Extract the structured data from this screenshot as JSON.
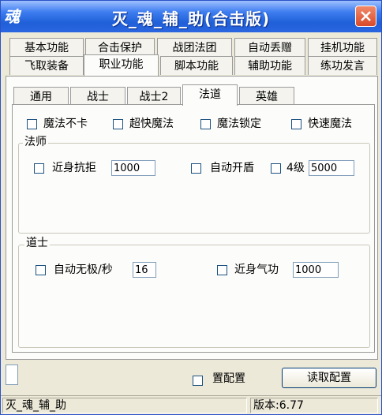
{
  "window": {
    "app_icon": "魂",
    "title": "灭_魂_辅_助(合击版)",
    "close_icon": "close-icon"
  },
  "tabs_row1": [
    {
      "label": "基本功能"
    },
    {
      "label": "合击保护"
    },
    {
      "label": "战团法团"
    },
    {
      "label": "自动丢赠"
    },
    {
      "label": "挂机功能"
    }
  ],
  "tabs_row2": [
    {
      "label": "飞取装备"
    },
    {
      "label": "职业功能"
    },
    {
      "label": "脚本功能"
    },
    {
      "label": "辅助功能"
    },
    {
      "label": "练功发言"
    }
  ],
  "subtabs": [
    {
      "label": "通用"
    },
    {
      "label": "战士"
    },
    {
      "label": "战士2"
    },
    {
      "label": "法道"
    },
    {
      "label": "英雄"
    }
  ],
  "top_checks": [
    {
      "label": "魔法不卡"
    },
    {
      "label": "超快魔法"
    },
    {
      "label": "魔法锁定"
    },
    {
      "label": "快速魔法"
    }
  ],
  "mage_group": {
    "title": "法师",
    "close_resist_label": "近身抗拒",
    "close_resist_value": "1000",
    "auto_shield_label": "自动开盾",
    "level4_label": "4级",
    "level4_value": "5000"
  },
  "taoist_group": {
    "title": "道士",
    "auto_wuji_label": "自动无极/秒",
    "auto_wuji_value": "16",
    "close_qigong_label": "近身气功",
    "close_qigong_value": "1000"
  },
  "bottom": {
    "small_field_value": "",
    "config_check_label": "置配置",
    "read_config_label": "读取配置"
  },
  "status": {
    "left_text": "灭_魂_辅_助",
    "version_text": "版本:6.77"
  }
}
